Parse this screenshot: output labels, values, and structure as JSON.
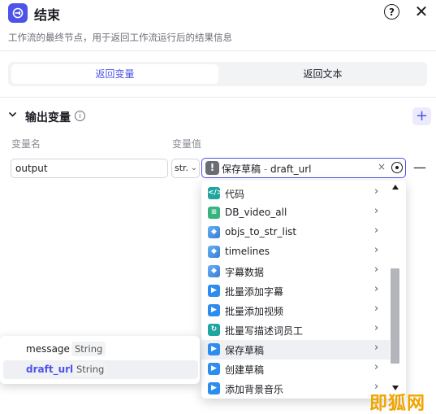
{
  "header": {
    "title": "结束",
    "description": "工作流的最终节点，用于返回工作流运行后的结果信息",
    "help_label": "?",
    "close_label": "✕"
  },
  "tabs": [
    {
      "label": "返回变量",
      "active": true
    },
    {
      "label": "返回文本",
      "active": false
    }
  ],
  "section": {
    "title": "输出变量",
    "collapse_icon": "chevron-down-icon",
    "info_icon": "info-icon",
    "add_label": "+"
  },
  "columns": {
    "name": "变量名",
    "value": "变量值"
  },
  "row": {
    "name_value": "output",
    "type_value": "str.",
    "value_source": "保存草稿",
    "value_separator": " - ",
    "value_var": "draft_url",
    "clear_label": "×",
    "remove_label": "—"
  },
  "dropdown": {
    "items": [
      {
        "label": "代码",
        "icon": "code-icon"
      },
      {
        "label": "DB_video_all",
        "icon": "database-icon"
      },
      {
        "label": "objs_to_str_list",
        "icon": "plugin-icon"
      },
      {
        "label": "timelines",
        "icon": "plugin-icon"
      },
      {
        "label": "字幕数据",
        "icon": "plugin-icon"
      },
      {
        "label": "批量添加字幕",
        "icon": "video-edit-icon"
      },
      {
        "label": "批量添加视频",
        "icon": "video-edit-icon"
      },
      {
        "label": "批量写描述词员工",
        "icon": "loop-icon"
      },
      {
        "label": "保存草稿",
        "icon": "video-edit-icon",
        "highlighted": true
      },
      {
        "label": "创建草稿",
        "icon": "video-edit-icon"
      },
      {
        "label": "添加背景音乐",
        "icon": "video-edit-icon"
      }
    ]
  },
  "variables": [
    {
      "name": "message",
      "type": "String"
    },
    {
      "name": "draft_url",
      "type": "String",
      "selected": true
    }
  ],
  "watermark": "即狐网",
  "colors": {
    "accent": "#4d53e8",
    "watermark": "#f0a400"
  }
}
